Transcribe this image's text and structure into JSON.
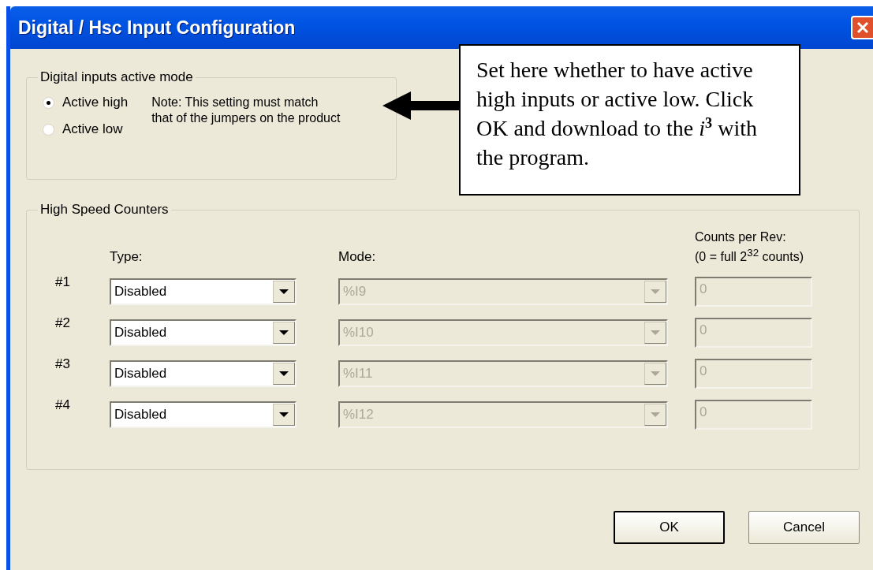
{
  "window": {
    "title": "Digital / Hsc Input Configuration"
  },
  "active_mode": {
    "title": "Digital inputs active mode",
    "options": [
      {
        "label": "Active high",
        "selected": true
      },
      {
        "label": "Active low",
        "selected": false
      }
    ],
    "note": "Note: This setting must match that of the jumpers on the product"
  },
  "callout": {
    "text": "Set here whether to have active high inputs or active low. Click OK and download to the *i*$^{3}$ with the program."
  },
  "counters": {
    "title": "High Speed Counters",
    "columns": {
      "type": "Type:",
      "mode": "Mode:",
      "counts": [
        "Counts per Rev:",
        "(0 = full 2$^{32}$ counts)"
      ]
    },
    "rows": [
      {
        "label": "#1",
        "type": "Disabled",
        "type_disabled": false,
        "mode": "%I9",
        "mode_disabled": true,
        "counts": "0",
        "counts_disabled": true
      },
      {
        "label": "#2",
        "type": "Disabled",
        "type_disabled": false,
        "mode": "%I10",
        "mode_disabled": true,
        "counts": "0",
        "counts_disabled": true
      },
      {
        "label": "#3",
        "type": "Disabled",
        "type_disabled": false,
        "mode": "%I11",
        "mode_disabled": true,
        "counts": "0",
        "counts_disabled": true
      },
      {
        "label": "#4",
        "type": "Disabled",
        "type_disabled": false,
        "mode": "%I12",
        "mode_disabled": true,
        "counts": "0",
        "counts_disabled": true
      }
    ]
  },
  "buttons": [
    {
      "label": "OK",
      "default": true
    },
    {
      "label": "Cancel",
      "default": false
    }
  ]
}
